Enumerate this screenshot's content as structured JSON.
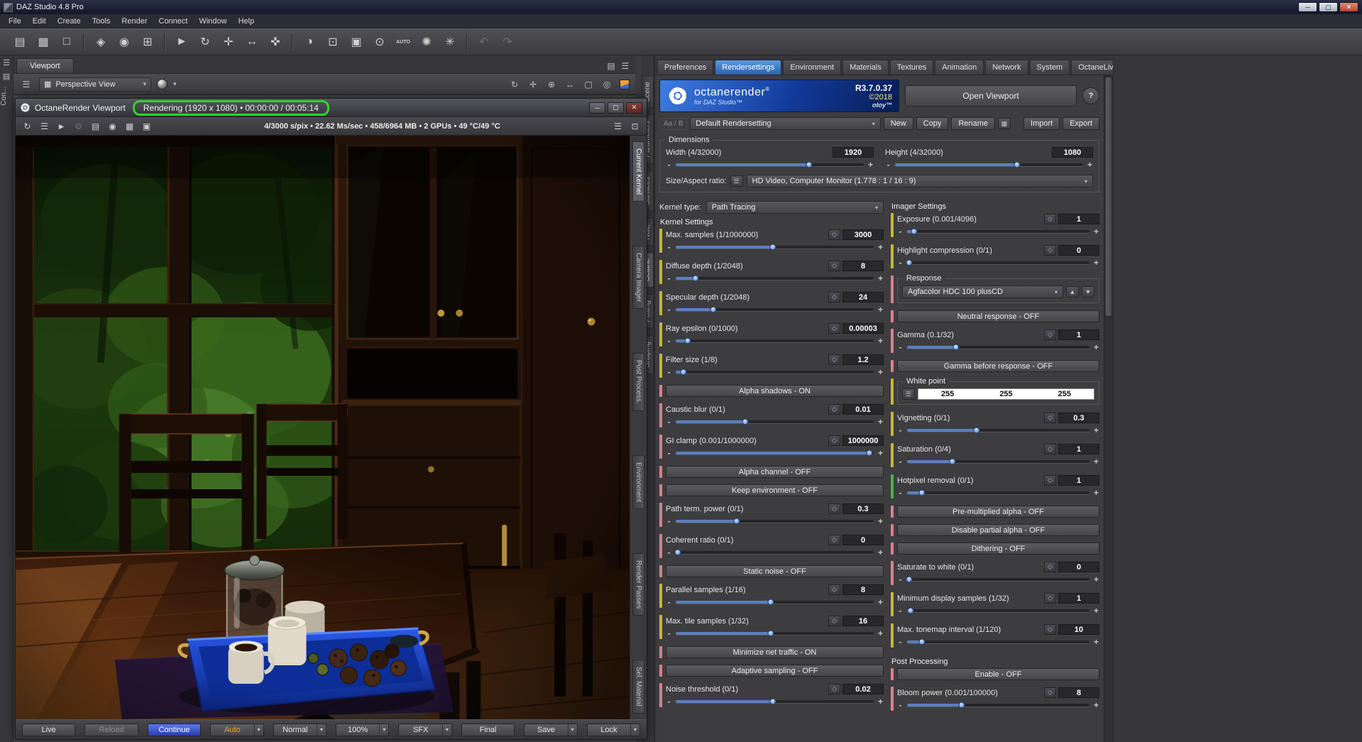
{
  "window": {
    "title": "DAZ Studio 4.8 Pro"
  },
  "glyphs": {
    "dropdown": "▾",
    "minus": "-",
    "plus": "+",
    "diamond": "◇",
    "up": "▲",
    "down": "▼",
    "list": "☰",
    "help": "?",
    "min": "─",
    "max": "▢",
    "close": "✕",
    "dots": "⋮"
  },
  "menu": {
    "items": [
      "File",
      "Edit",
      "Create",
      "Tools",
      "Render",
      "Connect",
      "Window",
      "Help"
    ]
  },
  "toolbar": {
    "icons": [
      {
        "name": "open-file-icon",
        "glyph": "▤"
      },
      {
        "name": "save-file-icon",
        "glyph": "▦"
      },
      {
        "name": "new-file-icon",
        "glyph": "□"
      },
      {
        "sep": true
      },
      {
        "name": "import-icon",
        "glyph": "◈"
      },
      {
        "name": "puppeteer-icon",
        "glyph": "◉"
      },
      {
        "name": "timeline-icon",
        "glyph": "⊞"
      },
      {
        "sep": true
      },
      {
        "name": "pointer-tool-icon",
        "glyph": "►"
      },
      {
        "name": "rotate-tool-icon",
        "glyph": "↻"
      },
      {
        "name": "translate-tool-icon",
        "glyph": "✛"
      },
      {
        "name": "scale-tool-icon",
        "glyph": "↔"
      },
      {
        "name": "universal-tool-icon",
        "glyph": "✜"
      },
      {
        "sep": true
      },
      {
        "name": "surface-tool-icon",
        "glyph": "◑"
      },
      {
        "name": "region-tool-icon",
        "glyph": "⊡"
      },
      {
        "name": "spot-render-icon",
        "glyph": "▣"
      },
      {
        "name": "render-icon",
        "glyph": "⊙"
      },
      {
        "name": "auto-render-icon",
        "glyph": "AUTO",
        "small": true
      },
      {
        "name": "octane-render-icon",
        "glyph": "✺"
      },
      {
        "name": "octane-settings-icon",
        "glyph": "✳"
      },
      {
        "sep": true
      },
      {
        "name": "undo-icon",
        "glyph": "↶",
        "disabled": true
      },
      {
        "name": "redo-icon",
        "glyph": "↷",
        "disabled": true
      }
    ]
  },
  "left_strip": {
    "icons": [
      {
        "name": "pane-dock-icon",
        "glyph": "▤"
      },
      {
        "name": "pane-menu-icon",
        "glyph": "☰"
      }
    ],
    "collapsed_label": "Con..."
  },
  "viewport_pane": {
    "tab_label": "Viewport",
    "camera_icon": "▦",
    "camera_value": "Perspective View",
    "pane_icons": [
      {
        "name": "pane-grid-icon",
        "glyph": "▤"
      },
      {
        "name": "pane-options-icon",
        "glyph": "☰"
      }
    ],
    "left_icon": "☰",
    "right_icons": [
      {
        "name": "orbit-tool-icon",
        "glyph": "↻"
      },
      {
        "name": "pan-tool-icon",
        "glyph": "✛"
      },
      {
        "name": "zoom-tool-icon",
        "glyph": "⊕"
      },
      {
        "name": "dolly-tool-icon",
        "glyph": "↔"
      },
      {
        "name": "frame-tool-icon",
        "glyph": "▢"
      },
      {
        "name": "aim-tool-icon",
        "glyph": "◎"
      }
    ]
  },
  "octane_viewport": {
    "title": "OctaneRender Viewport",
    "status": "Rendering (1920 x 1080) • 00:00:00 / 00:05:14",
    "stats": "4/3000 s/pix • 22.62 Ms/sec • 458/6964 MB • 2 GPUs • 49 °C/49 °C",
    "toolbar_icons": [
      {
        "name": "restart-render-icon",
        "glyph": "↻"
      },
      {
        "name": "render-options-icon",
        "glyph": "☰"
      },
      {
        "name": "pick-tool-icon",
        "glyph": "►"
      },
      {
        "name": "render-settings-icon",
        "glyph": "⚙",
        "disabled": true
      },
      {
        "name": "film-settings-icon",
        "glyph": "▤"
      },
      {
        "name": "material-ball-icon",
        "glyph": "◉"
      },
      {
        "name": "subsample-grid-icon",
        "glyph": "▦"
      },
      {
        "name": "save-image-icon",
        "glyph": "▣"
      }
    ],
    "toolbar_right_icons": [
      {
        "name": "render-log-icon",
        "glyph": "☰"
      },
      {
        "name": "camera-lock-icon",
        "glyph": "⊡"
      }
    ],
    "side_tabs": [
      "Current Kernel",
      "Camera Imager",
      "Post Process.",
      "Environment",
      "Render Passes",
      "Sel. Material"
    ],
    "side_tabs_active": 0,
    "bottom_buttons": [
      {
        "label": "Live"
      },
      {
        "label": "Reload",
        "disabled": true
      },
      {
        "label": "Continue",
        "accent": true
      },
      {
        "label": "Auto",
        "orange": true,
        "arrow": true
      },
      {
        "label": "Normal",
        "arrow": true
      },
      {
        "label": "100%",
        "arrow": true
      },
      {
        "label": "SFX",
        "arrow": true
      },
      {
        "label": "Final"
      },
      {
        "label": "Save",
        "arrow": true
      },
      {
        "label": "Lock",
        "arrow": true
      }
    ]
  },
  "right_dock": {
    "side_tabs": [
      "Scene",
      "Parameters",
      "Surfaces",
      "NGE",
      "Octane",
      "Posing",
      "Shaping"
    ],
    "active": 4
  },
  "octane_panel": {
    "tabs": [
      "Preferences",
      "Rendersettings",
      "Environment",
      "Materials",
      "Textures",
      "Animation",
      "Network",
      "System",
      "OctaneLive"
    ],
    "active_tab": "Rendersettings",
    "banner": {
      "brand": "octanerender",
      "reg": "®",
      "sub": "for DAZ Studio™",
      "version": "R3.7.0.37",
      "year": "©2018",
      "otoy": "otoy™"
    },
    "open_viewport_label": "Open Viewport",
    "preset": {
      "ab_label": "Aa / B",
      "value": "Default Rendersetting",
      "buttons": [
        "New",
        "Copy",
        "Rename"
      ],
      "icon_button": "▦",
      "buttons2": [
        "Import",
        "Export"
      ]
    },
    "dimensions": {
      "title": "Dimensions",
      "sliders": [
        {
          "label": "Width (4/32000)",
          "value": "1920",
          "pos": 71
        },
        {
          "label": "Height (4/32000)",
          "value": "1080",
          "pos": 65
        }
      ],
      "aspect_label": "Size/Aspect ratio:",
      "aspect_value": "HD Video, Computer Monitor (1.778 : 1 / 16 : 9)"
    },
    "kernel": {
      "type_label": "Kernel type:",
      "type_value": "Path Tracing",
      "section": "Kernel Settings",
      "items": [
        {
          "kind": "param",
          "label": "Max. samples (1/1000000)",
          "value": "3000",
          "pos": 49,
          "strip": "yellow"
        },
        {
          "kind": "param",
          "label": "Diffuse depth (1/2048)",
          "value": "8",
          "pos": 10,
          "strip": "yellow"
        },
        {
          "kind": "param",
          "label": "Specular depth (1/2048)",
          "value": "24",
          "pos": 19,
          "strip": "yellow"
        },
        {
          "kind": "param",
          "label": "Ray epsilon (0/1000)",
          "value": "0.00003",
          "pos": 6,
          "strip": "yellow"
        },
        {
          "kind": "param",
          "label": "Filter size (1/8)",
          "value": "1.2",
          "pos": 4,
          "strip": "yellow"
        },
        {
          "kind": "button",
          "label": "Alpha shadows - ON",
          "strip": "pink"
        },
        {
          "kind": "param",
          "label": "Caustic blur (0/1)",
          "value": "0.01",
          "pos": 35,
          "strip": "pink"
        },
        {
          "kind": "param",
          "label": "GI clamp (0.001/1000000)",
          "value": "1000000",
          "pos": 98,
          "strip": "pink"
        },
        {
          "kind": "button",
          "label": "Alpha channel - OFF",
          "strip": "pink"
        },
        {
          "kind": "button",
          "label": "Keep environment - OFF",
          "strip": "pink"
        },
        {
          "kind": "param",
          "label": "Path term. power (0/1)",
          "value": "0.3",
          "pos": 31,
          "strip": "pink"
        },
        {
          "kind": "param",
          "label": "Coherent ratio (0/1)",
          "value": "0",
          "pos": 1,
          "strip": "pink"
        },
        {
          "kind": "button",
          "label": "Static noise - OFF",
          "strip": "pink"
        },
        {
          "kind": "param",
          "label": "Parallel samples (1/16)",
          "value": "8",
          "pos": 48,
          "strip": "yellow"
        },
        {
          "kind": "param",
          "label": "Max. tile samples (1/32)",
          "value": "16",
          "pos": 48,
          "strip": "yellow"
        },
        {
          "kind": "button",
          "label": "Minimize net traffic - ON",
          "strip": "pink"
        },
        {
          "kind": "button",
          "label": "Adaptive sampling - OFF",
          "strip": "pink"
        },
        {
          "kind": "param",
          "label": "Noise threshold (0/1)",
          "value": "0.02",
          "pos": 49,
          "strip": "pink"
        }
      ]
    },
    "imager": {
      "section": "Imager Settings",
      "items": [
        {
          "kind": "param",
          "label": "Exposure (0.001/4096)",
          "value": "1",
          "pos": 4,
          "strip": "yellow"
        },
        {
          "kind": "param",
          "label": "Highlight compression (0/1)",
          "value": "0",
          "pos": 1,
          "strip": "yellow"
        },
        {
          "kind": "group_select",
          "title": "Response",
          "value": "Agfacolor HDC 100 plusCD",
          "strip": "pink"
        },
        {
          "kind": "button",
          "label": "Neutral response - OFF",
          "strip": "pink"
        },
        {
          "kind": "param",
          "label": "Gamma (0.1/32)",
          "value": "1",
          "pos": 27,
          "strip": "pink"
        },
        {
          "kind": "button",
          "label": "Gamma before response - OFF",
          "strip": "pink"
        },
        {
          "kind": "whitepoint",
          "title": "White point",
          "values": [
            "255",
            "255",
            "255"
          ],
          "strip": "yellow"
        },
        {
          "kind": "param",
          "label": "Vignetting (0/1)",
          "value": "0.3",
          "pos": 38,
          "strip": "yellow"
        },
        {
          "kind": "param",
          "label": "Saturation (0/4)",
          "value": "1",
          "pos": 25,
          "strip": "yellow"
        },
        {
          "kind": "param",
          "label": "Hotpixel removal (0/1)",
          "value": "1",
          "pos": 8,
          "strip": "green"
        },
        {
          "kind": "button",
          "label": "Pre-multiplied alpha - OFF",
          "strip": "pink"
        },
        {
          "kind": "button",
          "label": "Disable partial alpha - OFF",
          "strip": "pink"
        },
        {
          "kind": "button",
          "label": "Dithering - OFF",
          "strip": "pink"
        },
        {
          "kind": "param",
          "label": "Saturate to white (0/1)",
          "value": "0",
          "pos": 1,
          "strip": "pink"
        },
        {
          "kind": "param",
          "label": "Minimum display samples (1/32)",
          "value": "1",
          "pos": 2,
          "strip": "yellow"
        },
        {
          "kind": "param",
          "label": "Max. tonemap interval (1/120)",
          "value": "10",
          "pos": 8,
          "strip": "yellow"
        },
        {
          "kind": "section",
          "label": "Post Processing"
        },
        {
          "kind": "button",
          "label": "Enable - OFF",
          "strip": "pink"
        },
        {
          "kind": "param",
          "label": "Bloom power (0.001/100000)",
          "value": "8",
          "pos": 30,
          "strip": "pink"
        }
      ]
    }
  }
}
